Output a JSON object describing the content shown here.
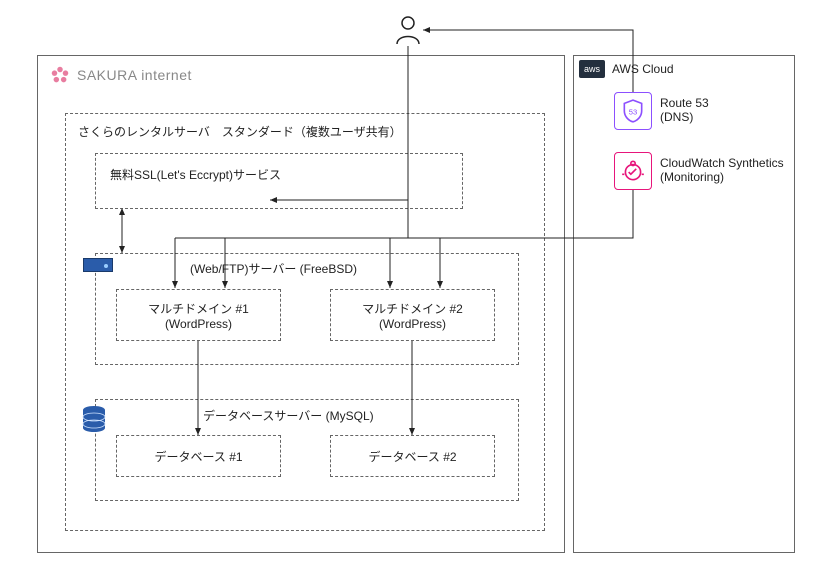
{
  "user_icon": "user-icon",
  "sakura": {
    "brand": "SAKURA internet",
    "outer_label": "",
    "rental_server": "さくらのレンタルサーバ　スタンダード（複数ユーザ共有）",
    "ssl_service": "無料SSL(Let's Eccrypt)サービス",
    "web_server": "(Web/FTP)サーバー (FreeBSD)",
    "multidomain1": {
      "title": "マルチドメイン #1",
      "sub": "(WordPress)"
    },
    "multidomain2": {
      "title": "マルチドメイン #2",
      "sub": "(WordPress)"
    },
    "db_server": "データベースサーバー (MySQL)",
    "db1": "データベース #1",
    "db2": "データベース #2"
  },
  "aws": {
    "title": "AWS Cloud",
    "route53": {
      "title": "Route 53",
      "sub": "(DNS)"
    },
    "cloudwatch": {
      "title": "CloudWatch Synthetics",
      "sub": "(Monitoring)"
    }
  }
}
